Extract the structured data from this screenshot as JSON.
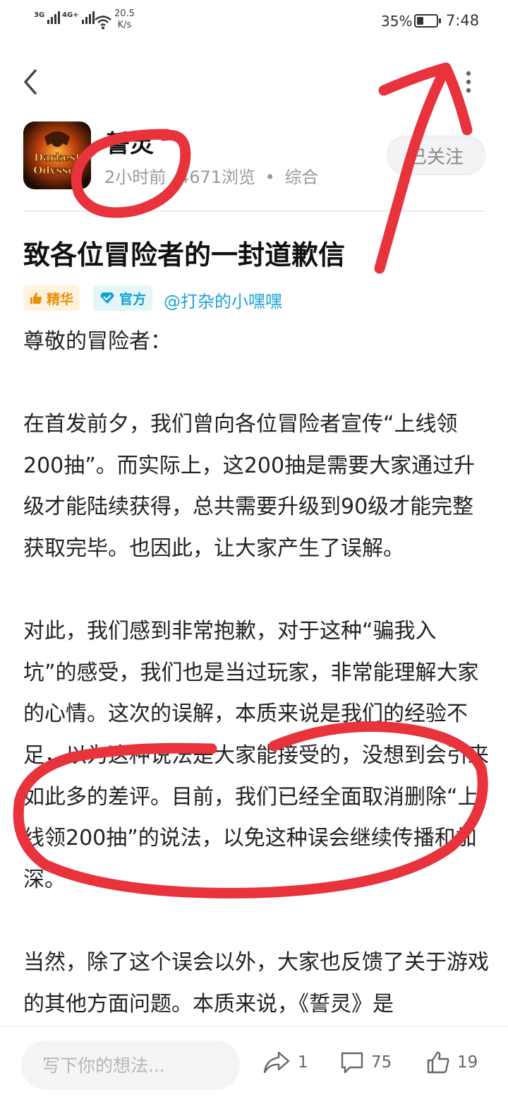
{
  "status_bar": {
    "signal1_tag": "3G",
    "signal2_tag": "4G+",
    "speed_value": "20.5",
    "speed_unit": "K/s",
    "battery_percent": "35%",
    "battery_level": 0.35,
    "time": "7:48"
  },
  "nav": {
    "back_icon": "chevron-left-icon",
    "more_icon": "more-vertical-icon"
  },
  "author": {
    "name": "誓灵",
    "avatar_text_top": "Darkest",
    "avatar_text_bottom": "Odyssey",
    "time_ago": "2小时前",
    "views": "4671浏览",
    "separator": "•",
    "category": "综合",
    "follow_label": "已关注"
  },
  "post": {
    "title": "致各位冒险者的一封道歉信",
    "badge_featured": "精华",
    "badge_official": "官方",
    "mention": "@打杂的小嘿嘿",
    "paragraphs": [
      "尊敬的冒险者：",
      "在首发前夕，我们曾向各位冒险者宣传“上线领200抽”。而实际上，这200抽是需要大家通过升级才能陆续获得，总共需要升级到90级才能完整获取完毕。也因此，让大家产生了误解。",
      "对此，我们感到非常抱歉，对于这种“骗我入坑”的感受，我们也是当过玩家，非常能理解大家的心情。这次的误解，本质来说是我们的经验不足，以为这种说法是大家能接受的，没想到会引来如此多的差评。目前，我们已经全面取消删除“上线领200抽”的说法，以免这种误会继续传播和加深。",
      "当然，除了这个误会以外，大家也反馈了关于游戏的其他方面问题。本质来说，《誓灵》是"
    ]
  },
  "bottom_bar": {
    "comment_placeholder": "写下你的想法...",
    "share_count": "1",
    "comment_count": "75",
    "like_count": "19"
  },
  "colors": {
    "annotation_red": "#e8323c",
    "accent_blue": "#1aa3d6",
    "featured_orange": "#e8900c"
  }
}
